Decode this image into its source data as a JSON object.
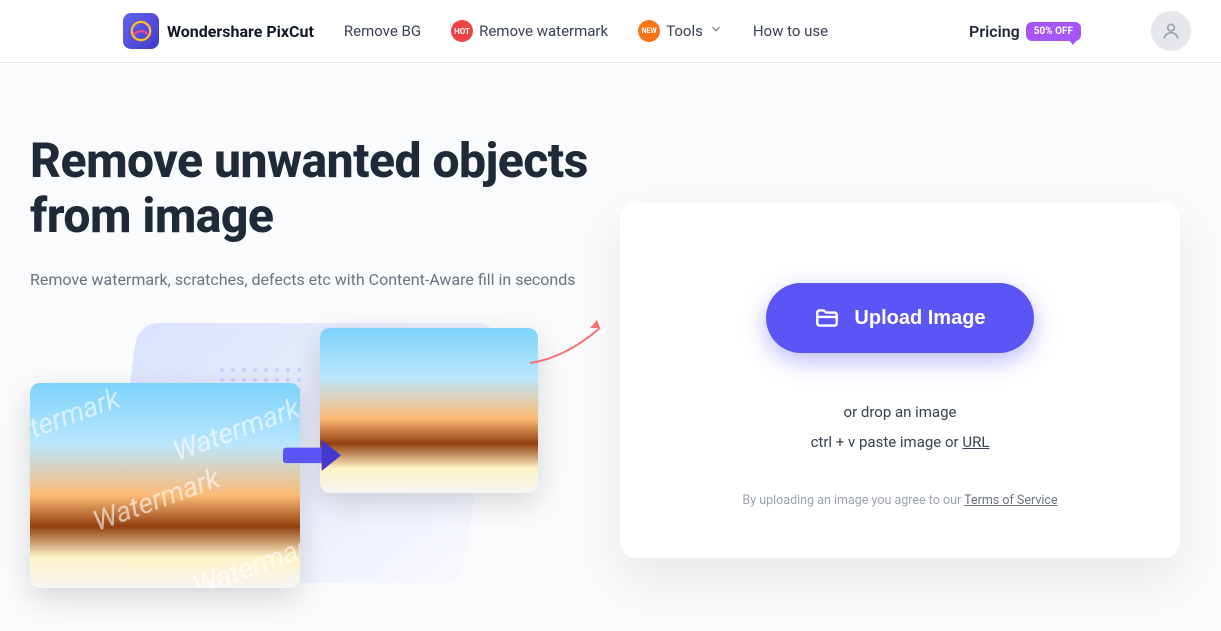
{
  "nav": {
    "brand": "Wondershare PixCut",
    "removeBg": "Remove BG",
    "removeWatermark": "Remove watermark",
    "tools": "Tools",
    "howToUse": "How to use",
    "pricing": "Pricing",
    "badgeHot": "HOT",
    "badgeNew": "NEW",
    "badgeOff": "50% OFF"
  },
  "hero": {
    "title": "Remove unwanted objects from image",
    "subtitle": "Remove watermark, scratches, defects etc with Content-Aware fill in seconds",
    "watermark": "Watermark"
  },
  "upload": {
    "button": "Upload Image",
    "drop": "or drop an image",
    "pastePrefix": "ctrl + v paste image or ",
    "pasteLink": "URL",
    "tosPrefix": "By uploading an image you agree to our ",
    "tosLink": "Terms of Service"
  }
}
